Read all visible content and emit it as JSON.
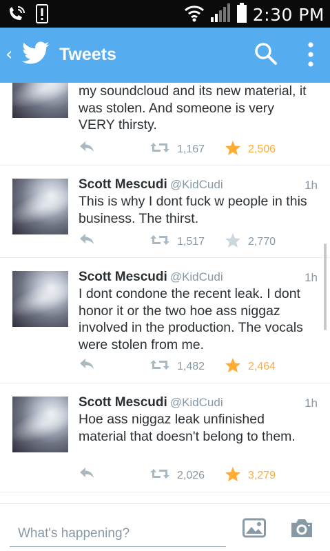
{
  "status_bar": {
    "time": "2:30 PM",
    "icons": [
      "wifi-calling-icon",
      "alert-icon",
      "wifi-icon",
      "signal-icon",
      "battery-icon"
    ]
  },
  "header": {
    "title": "Tweets",
    "back_icon": "back-chevron-icon",
    "logo_icon": "twitter-bird-icon",
    "search_icon": "search-icon",
    "menu_icon": "overflow-menu-icon",
    "bg_color": "#55acee"
  },
  "tweets": [
    {
      "name": "",
      "handle": "",
      "time": "",
      "text": "my soundcloud and its new material, it was stolen.  And someone is very VERY thirsty.",
      "retweets": "1,167",
      "favorites": "2,506",
      "favorited": true
    },
    {
      "name": "Scott Mescudi",
      "handle": "@KidCudi",
      "time": "1h",
      "text": "This is why I dont fuck w people in this business.  The thirst.",
      "retweets": "1,517",
      "favorites": "2,770",
      "favorited": false
    },
    {
      "name": "Scott Mescudi",
      "handle": "@KidCudi",
      "time": "1h",
      "text": "I dont condone the recent leak. I dont honor it or the two hoe ass niggaz involved in the production. The vocals were stolen from me.",
      "retweets": "1,482",
      "favorites": "2,464",
      "favorited": true
    },
    {
      "name": "Scott Mescudi",
      "handle": "@KidCudi",
      "time": "1h",
      "text": "Hoe ass niggaz leak unfinished material that doesn't belong to them.",
      "retweets": "2,026",
      "favorites": "3,279",
      "favorited": true
    }
  ],
  "composer": {
    "placeholder": "What's happening?",
    "photo_icon": "photo-icon",
    "camera_icon": "camera-icon"
  },
  "colors": {
    "accent": "#55acee",
    "favorite_active": "#ffac33",
    "muted": "#8899a6",
    "text": "#292f33"
  }
}
